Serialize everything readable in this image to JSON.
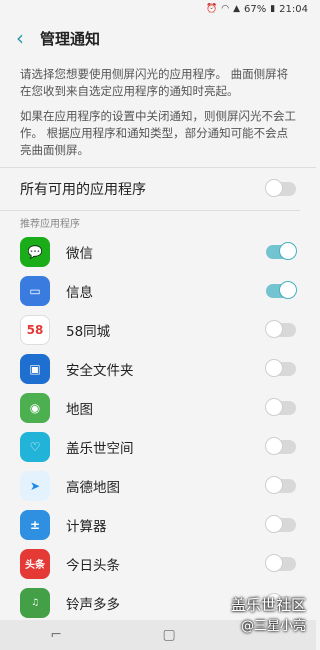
{
  "status": {
    "battery": "67%",
    "time": "21:04"
  },
  "header": {
    "title": "管理通知"
  },
  "description": {
    "p1": "请选择您想要使用侧屏闪光的应用程序。 曲面侧屏将在您收到来自选定应用程序的通知时亮起。",
    "p2": "如果在应用程序的设置中关闭通知，则侧屏闪光不会工作。 根据应用程序和通知类型，部分通知可能不会点亮曲面侧屏。"
  },
  "all_apps": {
    "label": "所有可用的应用程序",
    "enabled": false
  },
  "section_label": "推荐应用程序",
  "apps": [
    {
      "name": "微信",
      "enabled": true,
      "icon": "wechat-icon"
    },
    {
      "name": "信息",
      "enabled": true,
      "icon": "messages-icon"
    },
    {
      "name": "58同城",
      "enabled": false,
      "icon": "58-icon"
    },
    {
      "name": "安全文件夹",
      "enabled": false,
      "icon": "secure-folder-icon"
    },
    {
      "name": "地图",
      "enabled": false,
      "icon": "maps-icon"
    },
    {
      "name": "盖乐世空间",
      "enabled": false,
      "icon": "galaxy-space-icon"
    },
    {
      "name": "高德地图",
      "enabled": false,
      "icon": "amap-icon"
    },
    {
      "name": "计算器",
      "enabled": false,
      "icon": "calculator-icon"
    },
    {
      "name": "今日头条",
      "enabled": false,
      "icon": "toutiao-icon"
    },
    {
      "name": "铃声多多",
      "enabled": false,
      "icon": "ringtone-icon"
    }
  ],
  "watermark": {
    "line1": "盖乐世社区",
    "line2": "@三星小亮"
  },
  "colors": {
    "accent": "#48b0c1",
    "toggle_on": "#74c3d0"
  }
}
